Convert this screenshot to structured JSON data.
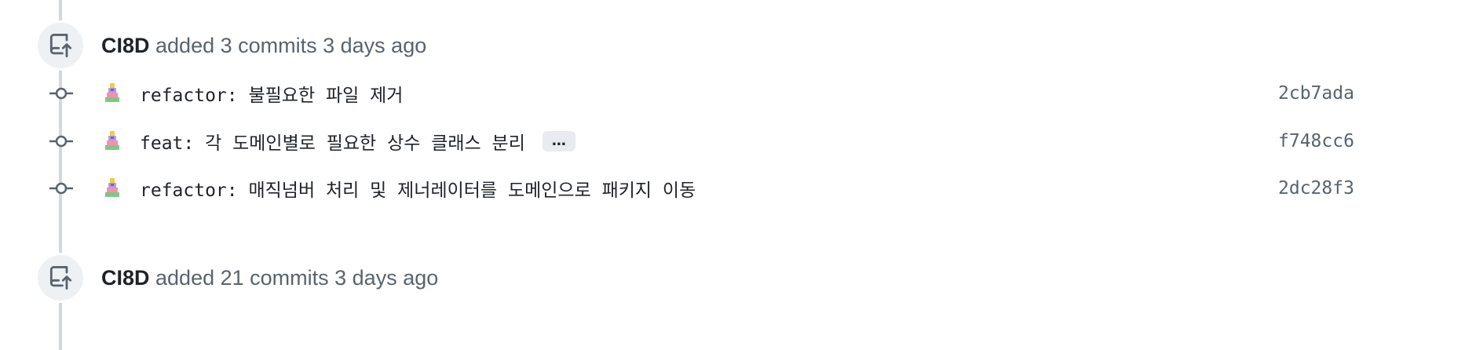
{
  "events": [
    {
      "author": "CI8D",
      "action": " added 3 commits ",
      "time": "3 days ago",
      "icon": "repo-push-icon",
      "commits": [
        {
          "message": "refactor: 불필요한 파일 제거",
          "sha": "2cb7ada",
          "has_more": false
        },
        {
          "message": "feat: 각 도메인별로 필요한 상수 클래스 분리",
          "sha": "f748cc6",
          "has_more": true,
          "more_label": "…"
        },
        {
          "message": "refactor: 매직넘버 처리 및 제너레이터를 도메인으로 패키지 이동",
          "sha": "2dc28f3",
          "has_more": false
        }
      ]
    },
    {
      "author": "CI8D",
      "action": " added 21 commits ",
      "time": "3 days ago",
      "icon": "repo-push-icon",
      "commits": []
    }
  ],
  "colors": {
    "timeline": "#d1d9e0",
    "badge_bg": "#eef1f4",
    "muted_text": "#59636e",
    "primary_text": "#1f2328"
  }
}
